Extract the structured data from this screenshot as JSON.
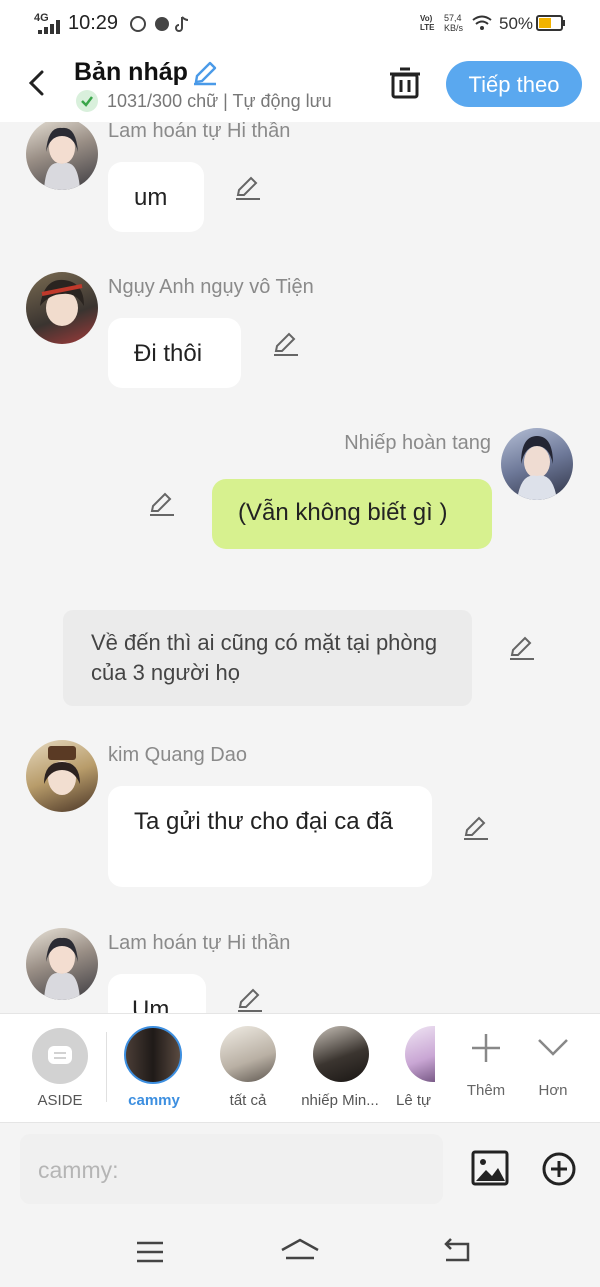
{
  "status_bar": {
    "time": "10:29",
    "network": "4G",
    "speed_value": "57,4",
    "speed_unit": "KB/s",
    "battery": "50%"
  },
  "header": {
    "title": "Bản nháp",
    "subtitle": "1031/300 chữ | Tự động lưu",
    "next_label": "Tiếp theo"
  },
  "messages": [
    {
      "speaker": "Lam hoán tự Hi thần",
      "text": "um"
    },
    {
      "speaker": "Ngụy Anh ngụy vô Tiện",
      "text": "Đi thôi"
    },
    {
      "speaker": "Nhiếp hoàn tang",
      "text": "(Vẫn không biết gì )"
    },
    {
      "speaker": "",
      "text": "Về đến thì ai cũng có mặt tại phòng của 3 người họ"
    },
    {
      "speaker": "kim Quang Dao",
      "text": "Ta gửi thư cho đại ca đã"
    },
    {
      "speaker": "Lam hoán tự Hi thần",
      "text": "Um"
    }
  ],
  "character_bar": {
    "items": [
      {
        "label": "ASIDE"
      },
      {
        "label": "cammy"
      },
      {
        "label": "tất cả"
      },
      {
        "label": "nhiếp Min..."
      },
      {
        "label": "Lê tự"
      }
    ],
    "more_label": "Thêm",
    "expand_label": "Hơn"
  },
  "input": {
    "placeholder": "cammy:"
  },
  "colors": {
    "accent": "#5aa8ef",
    "self_bubble": "#d7f18f",
    "active_name": "#3d8fe0"
  }
}
